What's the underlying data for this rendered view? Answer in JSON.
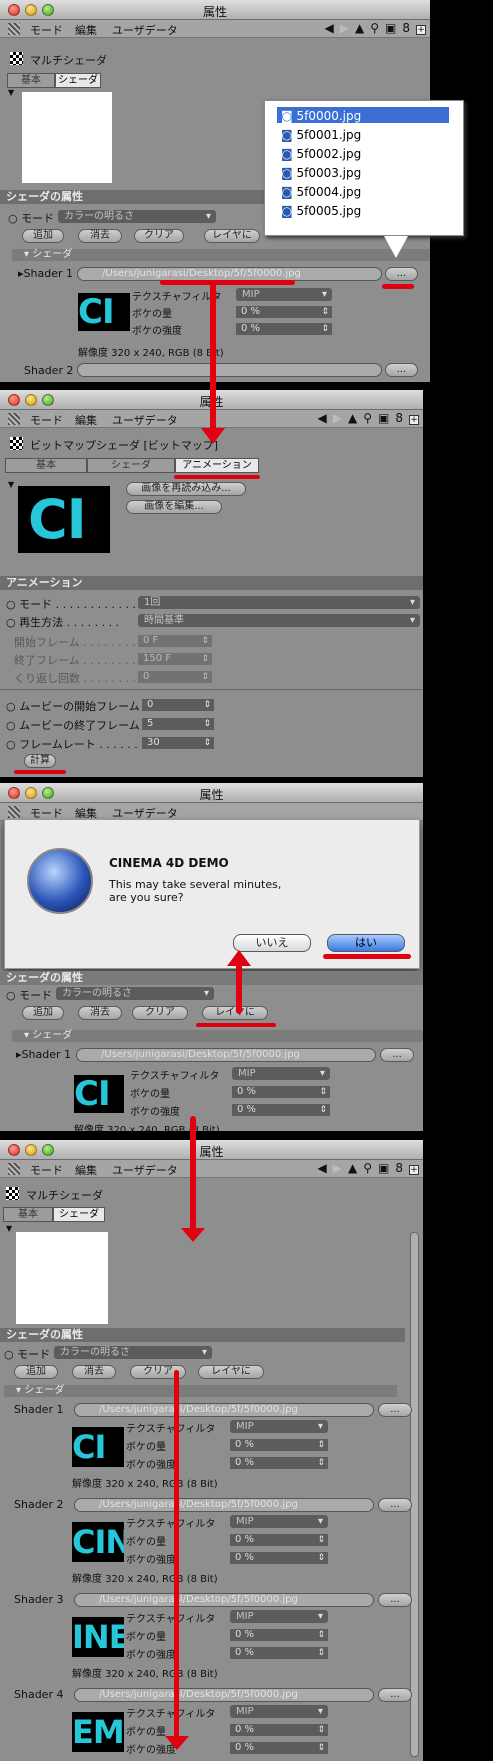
{
  "colors": {
    "accent_red": "#e00010",
    "cyan": "#27c6d8",
    "panel": "#8e8e8e"
  },
  "common": {
    "title": "属性",
    "menu_mode": "モード",
    "menu_edit": "編集",
    "menu_userdata": "ユーザデータ"
  },
  "p1": {
    "shader_name": "マルチシェーダ",
    "tab_basic": "基本",
    "tab_shader": "シェーダ",
    "attrs_header": "シェーダの属性",
    "mode_label": "モード",
    "mode_value": "カラーの明るさ",
    "btn_add": "追加",
    "btn_delete": "消去",
    "btn_clear": "クリア",
    "btn_layer": "レイヤに",
    "sub_header": "シェーダ",
    "shader1": "Shader 1",
    "path1": "/Users/junigarasi/Desktop/5f/5f0000.jpg",
    "tex_filter": "テクスチャフィルタ",
    "tex_filter_val": "MIP",
    "blur_amount": "ボケの量",
    "blur_val": "0 %",
    "blur_strength": "ボケの強度",
    "blur_strength_val": "0 %",
    "resolution": "解像度 320 x 240, RGB (8 Bit)",
    "shader2": "Shader 2",
    "ellipsis": "...",
    "thumb_text": "CI",
    "files": [
      "5f0000.jpg",
      "5f0001.jpg",
      "5f0002.jpg",
      "5f0003.jpg",
      "5f0004.jpg",
      "5f0005.jpg"
    ]
  },
  "p2": {
    "shader_name": "ビットマップシェーダ [ビットマップ]",
    "tab_basic": "基本",
    "tab_shader": "シェーダ",
    "tab_anim": "アニメーション",
    "btn_reload": "画像を再読み込み...",
    "btn_edit": "画像を編集...",
    "thumb_text": "CI",
    "anim_header": "アニメーション",
    "mode": "モード",
    "mode_val": "1回",
    "playback": "再生方法",
    "playback_val": "時間基準",
    "start_frame": "開始フレーム",
    "start_val": "0 F",
    "end_frame": "終了フレーム",
    "end_val": "150 F",
    "loops": "くり返し回数",
    "loops_val": "0",
    "movie_start": "ムービーの開始フレーム",
    "movie_start_val": "0",
    "movie_end": "ムービーの終了フレーム",
    "movie_end_val": "5",
    "frame_rate": "フレームレート",
    "frame_rate_val": "30",
    "calc_button": "計算"
  },
  "p3": {
    "title": "属性",
    "dialog_title": "CINEMA 4D DEMO",
    "dialog_msg": "This may take several minutes,\nare you sure?",
    "no": "いいえ",
    "yes": "はい",
    "attrs_header": "シェーダの属性",
    "mode_label": "モード",
    "mode_value": "カラーの明るさ",
    "btn_add": "追加",
    "btn_delete": "消去",
    "btn_clear": "クリア",
    "btn_layer": "レイヤに",
    "sub_header": "シェーダ",
    "shader1": "Shader 1",
    "path1": "/Users/junigarasi/Desktop/5f/5f0000.jpg",
    "tex_filter": "テクスチャフィルタ",
    "tex_filter_val": "MIP",
    "blur_amount": "ボケの量",
    "blur_val": "0 %",
    "blur_strength": "ボケの強度",
    "resolution": "解像度 320 x 240, RGB (8 Bit)",
    "thumb_text": "CI",
    "ellipsis": "..."
  },
  "p4": {
    "shader_name": "マルチシェーダ",
    "tab_basic": "基本",
    "tab_shader": "シェーダ",
    "attrs_header": "シェーダの属性",
    "mode_label": "モード",
    "mode_value": "カラーの明るさ",
    "btn_add": "追加",
    "btn_delete": "消去",
    "btn_clear": "クリア",
    "btn_layer": "レイヤに",
    "sub_header": "シェーダ",
    "tex_filter": "テクスチャフィルタ",
    "tex_filter_val": "MIP",
    "blur_amount": "ボケの量",
    "blur_strength": "ボケの強度",
    "pct": "0 %",
    "resolution": "解像度 320 x 240, RGB (8 Bit)",
    "ellipsis": "...",
    "shaders": [
      {
        "name": "Shader 1",
        "path": "/Users/junigarasi/Desktop/5f/5f0000.jpg",
        "thumb": "CI"
      },
      {
        "name": "Shader 2",
        "path": "/Users/junigarasi/Desktop/5f/5f0000.jpg",
        "thumb": "CIN"
      },
      {
        "name": "Shader 3",
        "path": "/Users/junigarasi/Desktop/5f/5f0000.jpg",
        "thumb": "INE"
      },
      {
        "name": "Shader 4",
        "path": "/Users/junigarasi/Desktop/5f/5f0000.jpg",
        "thumb": "EM"
      }
    ]
  }
}
